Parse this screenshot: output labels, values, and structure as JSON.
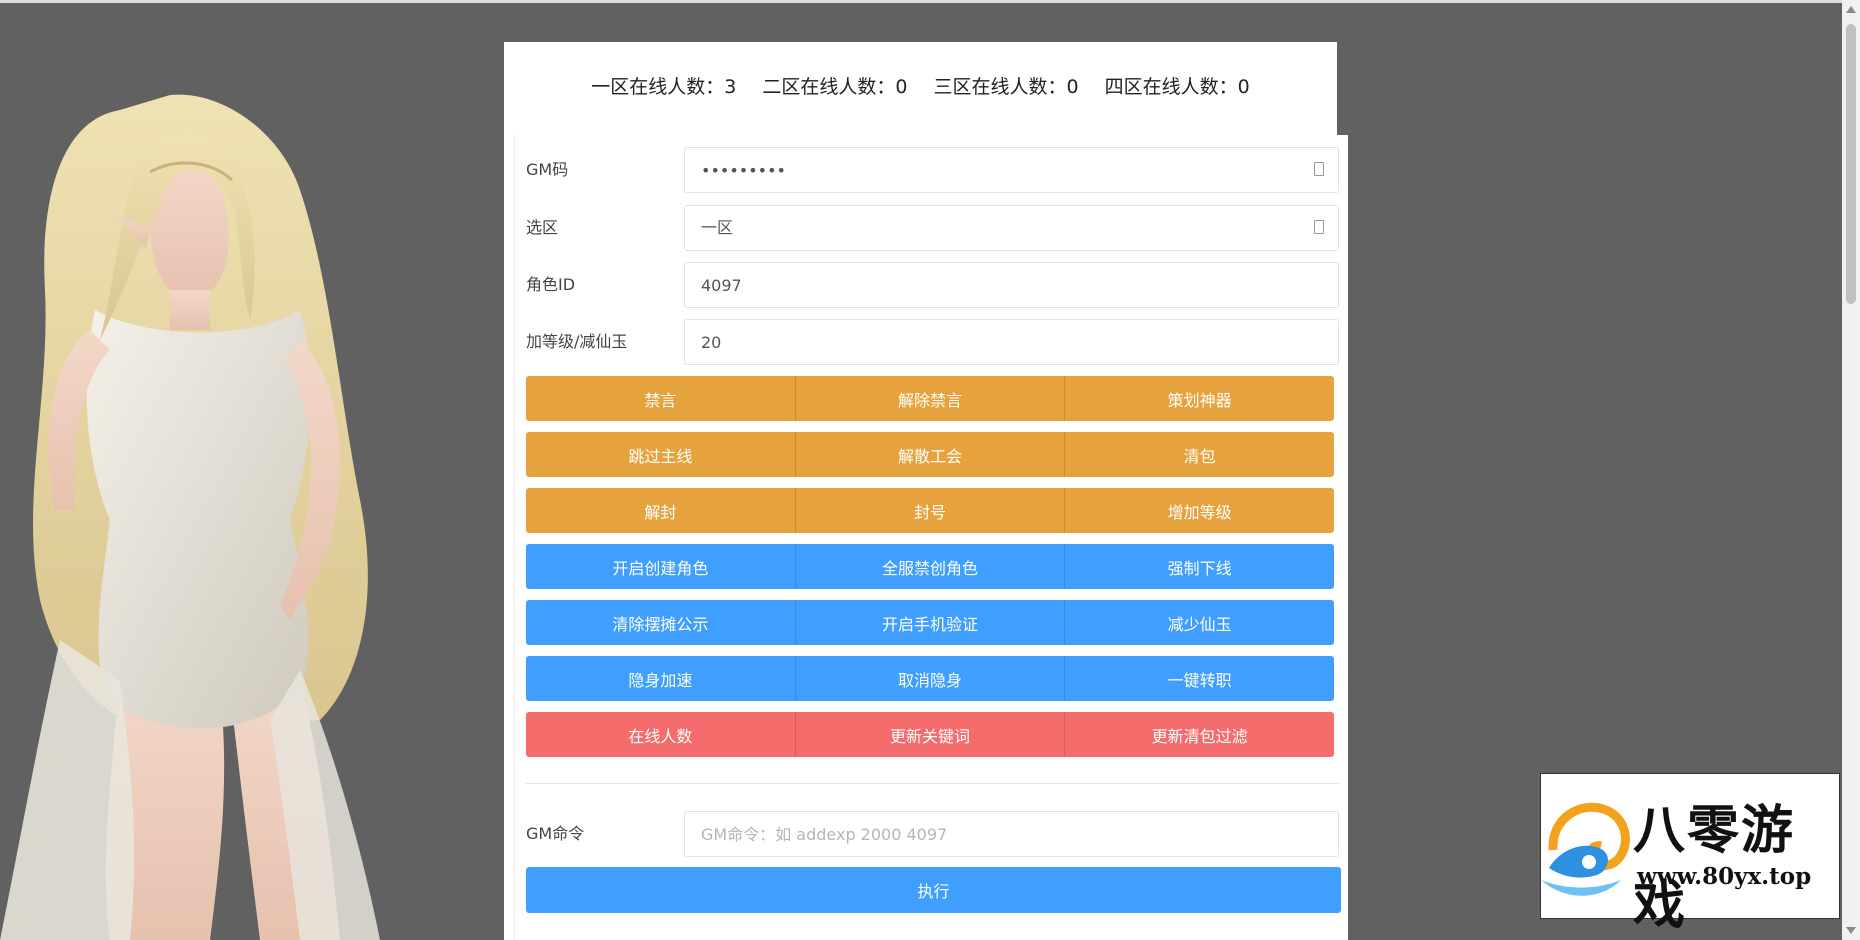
{
  "stats": {
    "zone1": "一区在线人数：3",
    "zone2": "二区在线人数：0",
    "zone3": "三区在线人数：0",
    "zone4": "四区在线人数：0"
  },
  "form": {
    "gm_code": {
      "label": "GM码",
      "value": "•••••••••"
    },
    "zone": {
      "label": "选区",
      "value": "一区"
    },
    "role_id": {
      "label": "角色ID",
      "value": "4097"
    },
    "amount": {
      "label": "加等级/减仙玉",
      "value": "20"
    }
  },
  "button_rows": [
    [
      "禁言",
      "解除禁言",
      "策划神器"
    ],
    [
      "跳过主线",
      "解散工会",
      "清包"
    ],
    [
      "解封",
      "封号",
      "增加等级"
    ],
    [
      "开启创建角色",
      "全服禁创角色",
      "强制下线"
    ],
    [
      "清除摆摊公示",
      "开启手机验证",
      "减少仙玉"
    ],
    [
      "隐身加速",
      "取消隐身",
      "一键转职"
    ],
    [
      "在线人数",
      "更新关键词",
      "更新清包过滤"
    ]
  ],
  "gm_command": {
    "label": "GM命令",
    "placeholder": "GM命令：如 addexp 2000 4097",
    "execute_label": "执行"
  },
  "logo": {
    "title": "八零游戏",
    "url": "www.80yx.top"
  },
  "colors": {
    "background": "#616161",
    "orange": "#e6a23c",
    "blue": "#409eff",
    "red": "#f56c6c"
  }
}
